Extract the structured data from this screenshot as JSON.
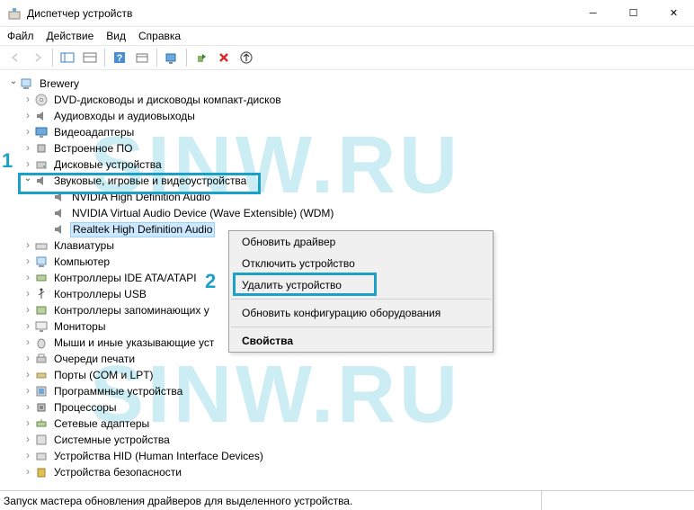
{
  "window": {
    "title": "Диспетчер устройств"
  },
  "menu": {
    "file": "Файл",
    "action": "Действие",
    "view": "Вид",
    "help": "Справка"
  },
  "root": {
    "name": "Brewery"
  },
  "categories": [
    {
      "label": "DVD-дисководы и дисководы компакт-дисков",
      "icon": "disc"
    },
    {
      "label": "Аудиовходы и аудиовыходы",
      "icon": "speaker"
    },
    {
      "label": "Видеоадаптеры",
      "icon": "monitor-blue"
    },
    {
      "label": "Встроенное ПО",
      "icon": "chip"
    },
    {
      "label": "Дисковые устройства",
      "icon": "disk"
    }
  ],
  "sound_category": {
    "label": "Звуковые, игровые и видеоустройства"
  },
  "sound_children": [
    {
      "label": "NVIDIA High Definition Audio"
    },
    {
      "label": "NVIDIA Virtual Audio Device (Wave Extensible) (WDM)"
    },
    {
      "label": "Realtek High Definition Audio"
    }
  ],
  "after": [
    {
      "label": "Клавиатуры",
      "icon": "keyboard"
    },
    {
      "label": "Компьютер",
      "icon": "pc"
    },
    {
      "label": "Контроллеры IDE ATA/ATAPI",
      "icon": "ide"
    },
    {
      "label": "Контроллеры USB",
      "icon": "usb"
    },
    {
      "label": "Контроллеры запоминающих у",
      "icon": "storage",
      "cut": true
    },
    {
      "label": "Мониторы",
      "icon": "monitor"
    },
    {
      "label": "Мыши и иные указывающие уст",
      "icon": "mouse",
      "cut": true
    },
    {
      "label": "Очереди печати",
      "icon": "printer"
    },
    {
      "label": "Порты (COM и LPT)",
      "icon": "port"
    },
    {
      "label": "Программные устройства",
      "icon": "software"
    },
    {
      "label": "Процессоры",
      "icon": "cpu"
    },
    {
      "label": "Сетевые адаптеры",
      "icon": "net"
    },
    {
      "label": "Системные устройства",
      "icon": "system"
    },
    {
      "label": "Устройства HID (Human Interface Devices)",
      "icon": "hid"
    },
    {
      "label": "Устройства безопасности",
      "icon": "security"
    }
  ],
  "context": {
    "update": "Обновить драйвер",
    "disable": "Отключить устройство",
    "remove": "Удалить устройство",
    "refresh": "Обновить конфигурацию оборудования",
    "props": "Свойства"
  },
  "annotations": {
    "a1": "1",
    "a2": "2"
  },
  "status": "Запуск мастера обновления драйверов для выделенного устройства.",
  "watermark": "SINW.RU"
}
